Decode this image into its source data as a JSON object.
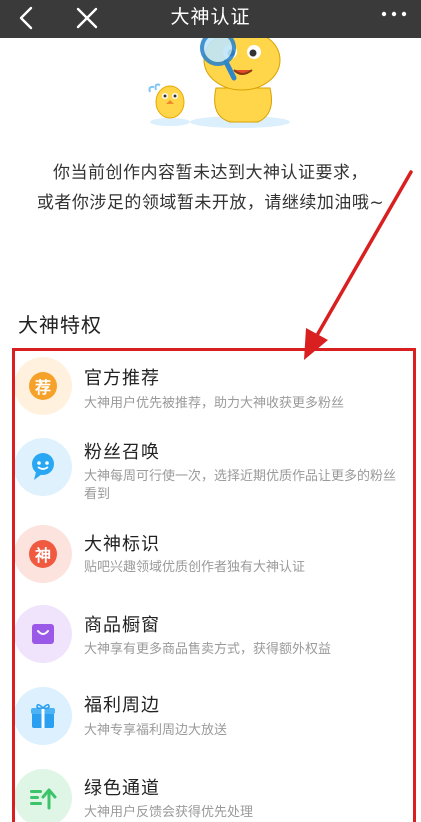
{
  "header": {
    "title": "大神认证",
    "back_icon": "back-chevron-icon",
    "close_icon": "close-icon",
    "more_icon": "more-dots-icon"
  },
  "notice": {
    "line1": "你当前创作内容暂未达到大神认证要求，",
    "line2": "或者你涉足的领域暂未开放，请继续加油哦~"
  },
  "section_title": "大神特权",
  "perks": [
    {
      "title": "官方推荐",
      "desc": "大神用户优先被推荐，助力大神收获更多粉丝",
      "icon": "recommend-icon",
      "icon_text": "荐",
      "color": "#f6a12a"
    },
    {
      "title": "粉丝召唤",
      "desc": "大神每周可行使一次，选择近期优质作品让更多的粉丝看到",
      "icon": "fans-summon-icon",
      "icon_text": "",
      "color": "#2aa7f2"
    },
    {
      "title": "大神标识",
      "desc": "贴吧兴趣领域优质创作者独有大神认证",
      "icon": "god-badge-icon",
      "icon_text": "神",
      "color": "#f05a40"
    },
    {
      "title": "商品橱窗",
      "desc": "大神享有更多商品售卖方式，获得额外权益",
      "icon": "shop-window-icon",
      "icon_text": "",
      "color": "#9b59e8"
    },
    {
      "title": "福利周边",
      "desc": "大神专享福利周边大放送",
      "icon": "gift-icon",
      "icon_text": "",
      "color": "#2b9ff0"
    },
    {
      "title": "绿色通道",
      "desc": "大神用户反馈会获得优先处理",
      "icon": "green-channel-icon",
      "icon_text": "",
      "color": "#3cc46a"
    }
  ]
}
